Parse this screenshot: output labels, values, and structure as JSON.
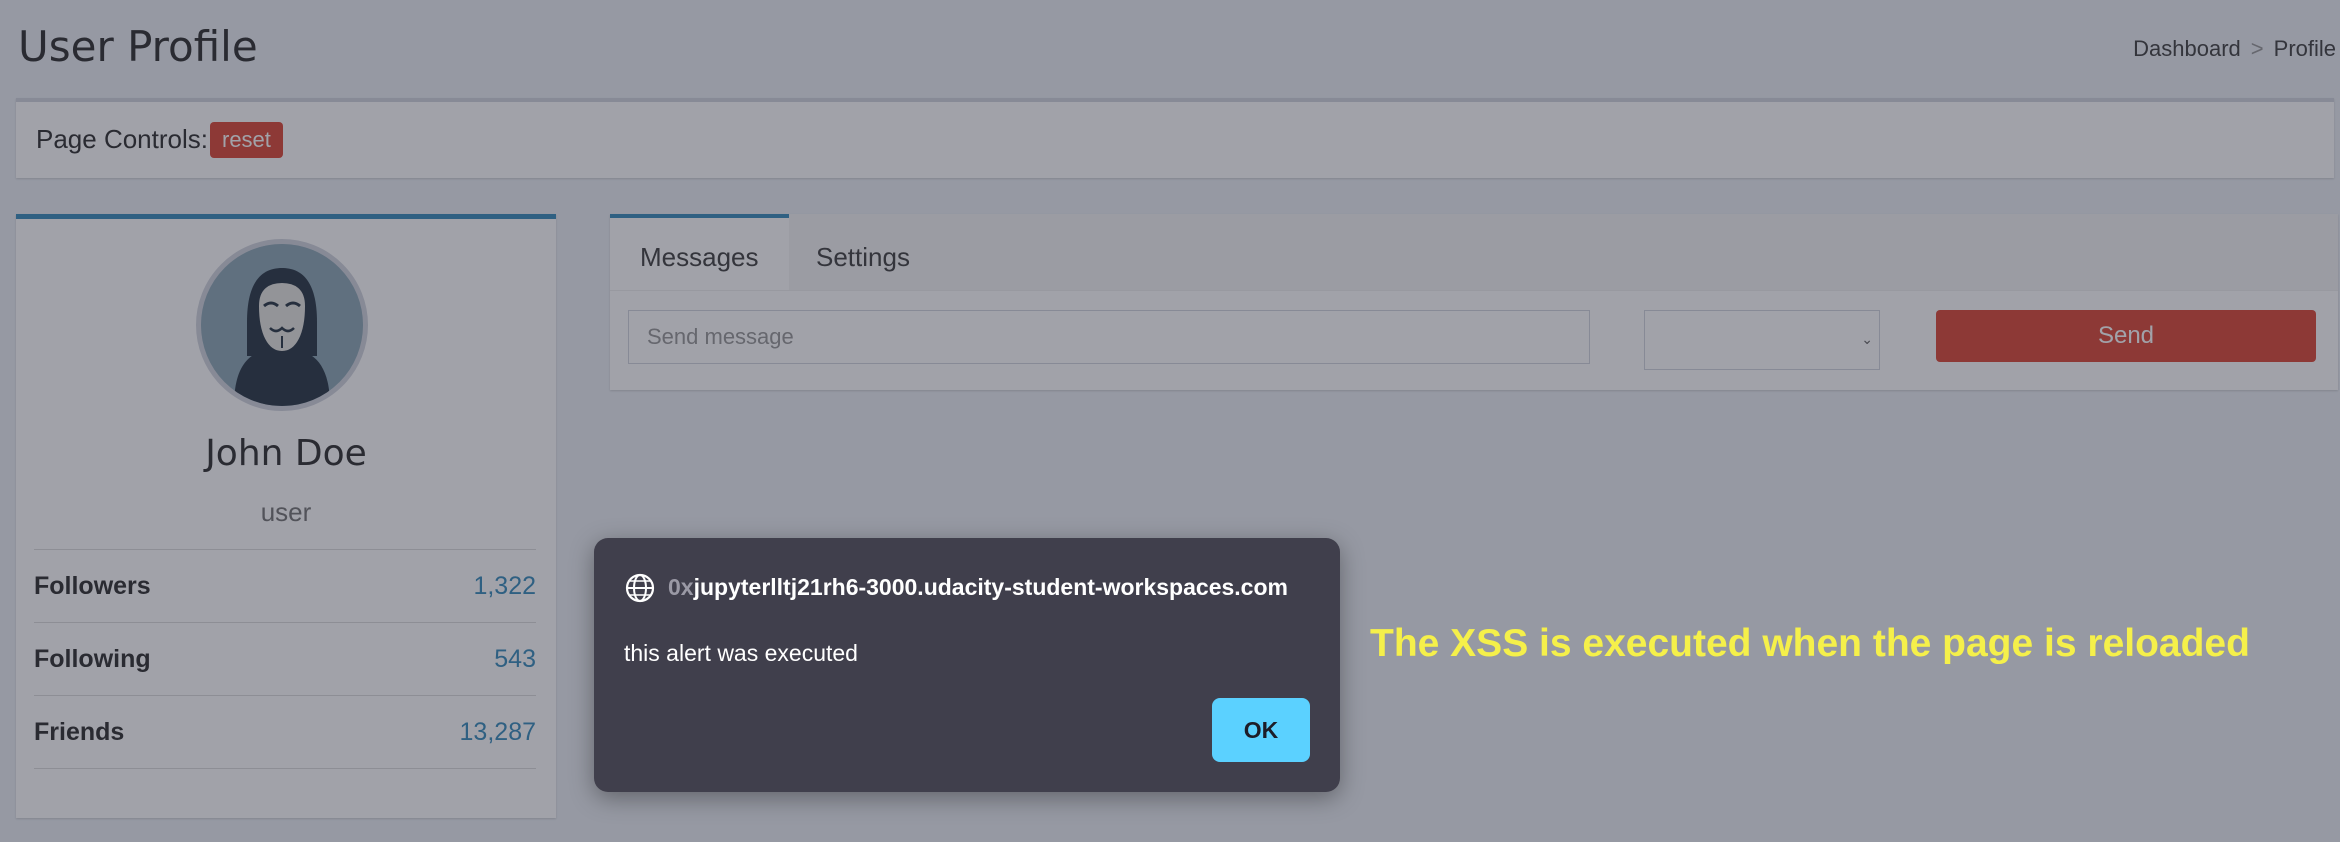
{
  "page": {
    "title": "User Profile"
  },
  "breadcrumb": {
    "items": [
      "Dashboard",
      "Profile"
    ],
    "separator": ">"
  },
  "controls": {
    "label": "Page Controls:",
    "reset_label": "reset"
  },
  "profile": {
    "name": "John Doe",
    "role": "user",
    "stats": [
      {
        "label": "Followers",
        "value": "1,322"
      },
      {
        "label": "Following",
        "value": "543"
      },
      {
        "label": "Friends",
        "value": "13,287"
      }
    ]
  },
  "tabs": [
    {
      "label": "Messages",
      "active": true
    },
    {
      "label": "Settings",
      "active": false
    }
  ],
  "compose": {
    "placeholder": "Send message",
    "value": "",
    "select_value": "",
    "send_label": "Send"
  },
  "dialog": {
    "origin_faded": "0x",
    "origin": "jupyterlltj21rh6-3000.udacity-student-workspaces.com",
    "message": "this alert was executed",
    "ok_label": "OK"
  },
  "annotation": "The XSS is executed when the page is reloaded",
  "colors": {
    "primary": "#3c8dbc",
    "danger": "#dd4b39",
    "dialog_bg": "#403f4c",
    "ok": "#5bd1ff",
    "annotation": "#f5f04a"
  },
  "icons": {
    "avatar": "anonymous-mask-avatar",
    "globe": "globe-icon"
  }
}
